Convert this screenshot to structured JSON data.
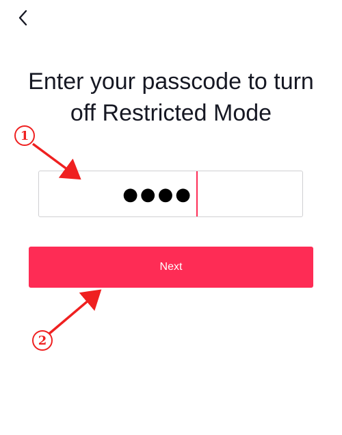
{
  "header": {
    "back_icon": "chevron-left-icon"
  },
  "title": {
    "line1": "Enter your passcode to turn",
    "line2": "off Restricted Mode"
  },
  "passcode": {
    "masked_value": "●●●●"
  },
  "next_button": {
    "label": "Next"
  },
  "annotations": {
    "marker1": "1",
    "marker2": "2"
  },
  "colors": {
    "accent": "#fe2c55",
    "annotation": "#ef2020",
    "text": "#161823",
    "border": "#cfcfd2"
  }
}
